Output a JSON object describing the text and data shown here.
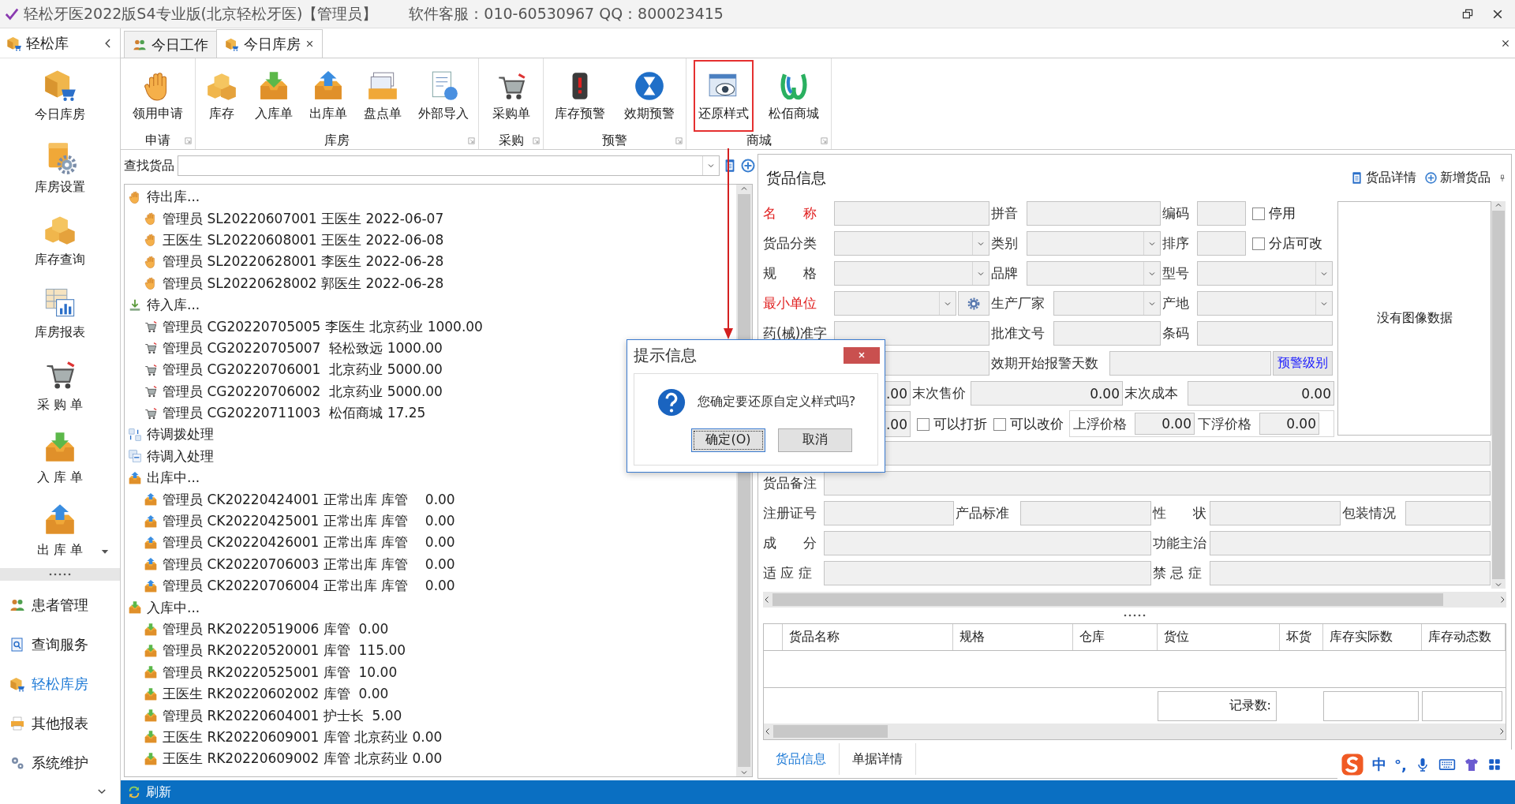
{
  "window": {
    "title": "轻松牙医2022版S4专业版(北京轻松牙医)【管理员】",
    "support": "软件客服：010-60530967 QQ：800023415"
  },
  "sidebar": {
    "title": "轻松库",
    "modules": [
      {
        "label": "今日库房"
      },
      {
        "label": "库房设置"
      },
      {
        "label": "库存查询"
      },
      {
        "label": "库房报表"
      },
      {
        "label": "采 购 单"
      },
      {
        "label": "入 库 单"
      },
      {
        "label": "出 库 单"
      }
    ],
    "nav": [
      {
        "label": "患者管理",
        "selected": false
      },
      {
        "label": "查询服务",
        "selected": false
      },
      {
        "label": "轻松库房",
        "selected": true
      },
      {
        "label": "其他报表",
        "selected": false
      },
      {
        "label": "系统维护",
        "selected": false
      }
    ]
  },
  "tabs": [
    {
      "label": "今日工作",
      "selected": false,
      "closable": false
    },
    {
      "label": "今日库房",
      "selected": true,
      "closable": true
    }
  ],
  "ribbon": {
    "groups": [
      {
        "label": "申请",
        "buttons": [
          {
            "label": "领用申请",
            "highlighted": false
          }
        ]
      },
      {
        "label": "库房",
        "buttons": [
          {
            "label": "库存",
            "highlighted": false
          },
          {
            "label": "入库单",
            "highlighted": false
          },
          {
            "label": "出库单",
            "highlighted": false
          },
          {
            "label": "盘点单",
            "highlighted": false
          },
          {
            "label": "外部导入",
            "highlighted": false
          }
        ]
      },
      {
        "label": "采购",
        "buttons": [
          {
            "label": "采购单",
            "highlighted": false
          }
        ]
      },
      {
        "label": "预警",
        "buttons": [
          {
            "label": "库存预警",
            "highlighted": false
          },
          {
            "label": "效期预警",
            "highlighted": false
          }
        ]
      },
      {
        "label": "商城",
        "buttons": [
          {
            "label": "还原样式",
            "highlighted": true
          },
          {
            "label": "松佰商城",
            "highlighted": false
          }
        ]
      }
    ]
  },
  "search": {
    "label": "查找货品"
  },
  "tree": [
    {
      "label": "待出库...",
      "children": [
        "管理员 SL20220607001 王医生 2022-06-07",
        "王医生 SL20220608001 王医生 2022-06-08",
        "管理员 SL20220628001 李医生 2022-06-28",
        "管理员 SL20220628002 郭医生 2022-06-28"
      ]
    },
    {
      "label": "待入库...",
      "children": [
        "管理员 CG20220705005 李医生 北京药业 1000.00",
        "管理员 CG20220705007  轻松致远 1000.00",
        "管理员 CG20220706001  北京药业 5000.00",
        "管理员 CG20220706002  北京药业 5000.00",
        "管理员 CG20220711003  松佰商城 17.25"
      ]
    },
    {
      "label": "待调拨处理"
    },
    {
      "label": "待调入处理"
    },
    {
      "label": "出库中...",
      "children": [
        "管理员 CK20220424001 正常出库 库管    0.00",
        "管理员 CK20220425001 正常出库 库管    0.00",
        "管理员 CK20220426001 正常出库 库管    0.00",
        "管理员 CK20220706003 正常出库 库管    0.00",
        "管理员 CK20220706004 正常出库 库管    0.00"
      ]
    },
    {
      "label": "入库中...",
      "children": [
        "管理员 RK20220519006 库管  0.00",
        "管理员 RK20220520001 库管  115.00",
        "管理员 RK20220525001 库管  10.00",
        "王医生 RK20220602002 库管  0.00",
        "管理员 RK20220604001 护士长  5.00",
        "王医生 RK20220609001 库管 北京药业 0.00",
        "王医生 RK20220609002 库管 北京药业 0.00"
      ]
    }
  ],
  "details": {
    "title": "货品信息",
    "actions": [
      "货品详情",
      "新增货品"
    ],
    "upper_rows": [
      [
        {
          "kind": "label",
          "text": "名　　称",
          "required": true
        },
        {
          "kind": "input"
        },
        {
          "kind": "label",
          "text": "拼音",
          "required": false
        },
        {
          "kind": "input"
        },
        {
          "kind": "label",
          "text": "编码",
          "required": false
        },
        {
          "kind": "input"
        },
        {
          "kind": "check",
          "text": "停用",
          "checked": false
        }
      ],
      [
        {
          "kind": "label",
          "text": "货品分类",
          "required": false
        },
        {
          "kind": "combo"
        },
        {
          "kind": "label",
          "text": "类别",
          "required": false
        },
        {
          "kind": "combo"
        },
        {
          "kind": "label",
          "text": "排序",
          "required": false
        },
        {
          "kind": "input"
        },
        {
          "kind": "check",
          "text": "分店可改",
          "checked": false
        }
      ],
      [
        {
          "kind": "label",
          "text": "规　　格",
          "required": false
        },
        {
          "kind": "combo"
        },
        {
          "kind": "label",
          "text": "品牌",
          "required": false
        },
        {
          "kind": "combo"
        },
        {
          "kind": "label",
          "text": "型号",
          "required": false
        },
        {
          "kind": "combo"
        }
      ],
      [
        {
          "kind": "label",
          "text": "最小单位",
          "required": true
        },
        {
          "kind": "combo"
        },
        {
          "kind": "settings"
        },
        {
          "kind": "label",
          "text": "生产厂家",
          "required": false
        },
        {
          "kind": "combo"
        },
        {
          "kind": "label",
          "text": "产地",
          "required": false
        },
        {
          "kind": "combo"
        }
      ],
      [
        {
          "kind": "label",
          "text": "药(械)准字",
          "required": false
        },
        {
          "kind": "input"
        },
        {
          "kind": "label",
          "text": "批准文号",
          "required": false
        },
        {
          "kind": "input"
        },
        {
          "kind": "label",
          "text": "条码",
          "required": false
        },
        {
          "kind": "input"
        }
      ],
      [
        {
          "kind": "input"
        },
        {
          "kind": "label",
          "text": "效期开始报警天数",
          "required": false
        },
        {
          "kind": "input"
        },
        {
          "kind": "link",
          "text": "预警级别"
        }
      ],
      [
        {
          "kind": "input",
          "value": ".00"
        },
        {
          "kind": "label",
          "text": "末次售价",
          "required": false
        },
        {
          "kind": "input",
          "value": "0.00"
        },
        {
          "kind": "label",
          "text": "末次成本",
          "required": false
        },
        {
          "kind": "input",
          "value": "0.00"
        }
      ],
      [
        {
          "kind": "input",
          "value": ".00"
        },
        {
          "kind": "check",
          "text": "可以打折",
          "checked": false
        },
        {
          "kind": "check",
          "text": "可以改价",
          "checked": false
        },
        {
          "kind": "group",
          "items": [
            {
              "kind": "label",
              "text": "上浮价格",
              "required": false
            },
            {
              "kind": "input",
              "value": "0.00"
            },
            {
              "kind": "label",
              "text": "下浮价格",
              "required": false
            },
            {
              "kind": "input",
              "value": "0.00"
            }
          ]
        }
      ]
    ],
    "image_placeholder": "没有图像数据",
    "lower_rows": [
      [
        {
          "kind": "input"
        }
      ],
      [
        {
          "kind": "label",
          "text": "货品备注",
          "required": false
        },
        {
          "kind": "input"
        }
      ],
      [
        {
          "kind": "label",
          "text": "注册证号",
          "required": false
        },
        {
          "kind": "input"
        },
        {
          "kind": "label",
          "text": "产品标准",
          "required": false
        },
        {
          "kind": "input"
        },
        {
          "kind": "label",
          "text": "性　　状",
          "required": false
        },
        {
          "kind": "input"
        },
        {
          "kind": "label",
          "text": "包装情况",
          "required": false
        },
        {
          "kind": "input"
        }
      ],
      [
        {
          "kind": "label",
          "text": "成　　分",
          "required": false
        },
        {
          "kind": "input"
        },
        {
          "kind": "label",
          "text": "功能主治",
          "required": false
        },
        {
          "kind": "input"
        }
      ],
      [
        {
          "kind": "label",
          "text": "适 应 症",
          "required": false
        },
        {
          "kind": "input"
        },
        {
          "kind": "label",
          "text": "禁 忌 症",
          "required": false
        },
        {
          "kind": "input"
        }
      ]
    ],
    "grid": {
      "columns": [
        "货品名称",
        "规格",
        "仓库",
        "货位",
        "坏货",
        "库存实际数",
        "库存动态数"
      ],
      "footer_label": "记录数:"
    },
    "tabs": [
      {
        "label": "货品信息",
        "selected": true
      },
      {
        "label": "单据详情",
        "selected": false
      }
    ]
  },
  "dialog": {
    "title": "提示信息",
    "message": "您确定要还原自定义样式吗?",
    "buttons": [
      {
        "label": "确定(O)",
        "focused": true
      },
      {
        "label": "取消",
        "focused": false
      }
    ]
  },
  "ime": {
    "mode": "中",
    "punct": "°,"
  },
  "status_bar": {
    "items": [
      "刷新"
    ]
  }
}
